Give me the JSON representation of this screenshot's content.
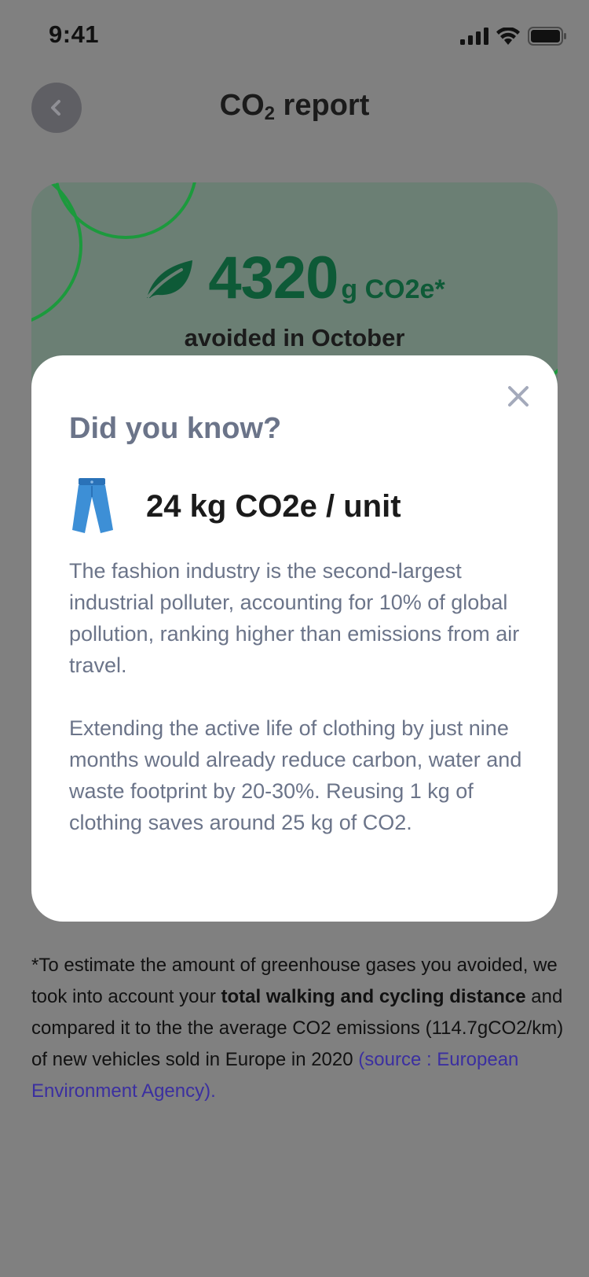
{
  "status": {
    "time": "9:41"
  },
  "header": {
    "title_main": "CO",
    "title_sub": "2",
    "title_rest": " report"
  },
  "summary": {
    "value": "4320",
    "unit": "g CO2e*",
    "caption": "avoided in October"
  },
  "modal": {
    "title": "Did you know?",
    "fact_value": "24 kg CO2e / unit",
    "paragraph_1": "The fashion industry is the second-largest industrial polluter, accounting for 10% of global pollution, ranking higher than emissions from air travel.",
    "paragraph_2": "Extending the active life of clothing by just nine months would already reduce carbon, water and waste footprint by 20-30%. Reusing 1 kg of clothing saves around 25 kg of CO2."
  },
  "footnote": {
    "part_1": "*To estimate the amount of greenhouse gases you avoided, we took into account your ",
    "bold": "total walking and cycling distance",
    "part_2": " and compared it to the the average CO2 emissions (114.7gCO2/km) of new vehicles sold in Europe in 2020 ",
    "source_link": "(source : European Environment Agency)."
  },
  "colors": {
    "accent_green": "#0e5a37",
    "link": "#3b2fa0",
    "muted_text": "#6b7489"
  },
  "icons": [
    "back-arrow-icon",
    "leaf-icon",
    "close-icon",
    "jeans-icon",
    "signal-icon",
    "wifi-icon",
    "battery-icon"
  ]
}
